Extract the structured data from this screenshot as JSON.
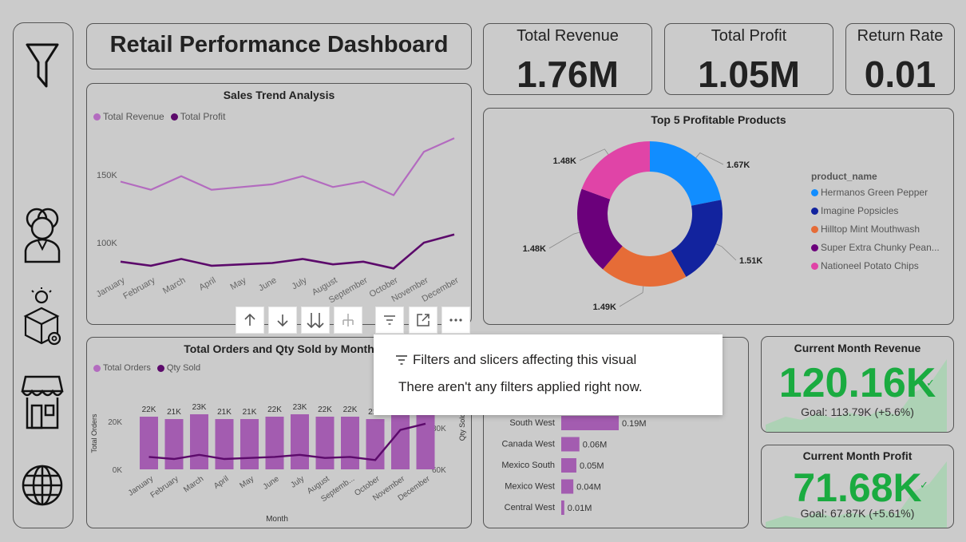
{
  "dashboard_title": "Retail Performance Dashboard",
  "kpis": {
    "revenue": {
      "label": "Total Revenue",
      "value": "1.76M"
    },
    "profit": {
      "label": "Total Profit",
      "value": "1.05M"
    },
    "return_rate": {
      "label": "Return Rate",
      "value": "0.01"
    }
  },
  "nav": {
    "icons": [
      "filter-icon",
      "people-icon",
      "product-box-icon",
      "store-icon",
      "globe-icon"
    ]
  },
  "sales_trend": {
    "title": "Sales Trend Analysis",
    "legend": [
      "Total Revenue",
      "Total Profit"
    ],
    "colors": {
      "revenue": "#b36bbf",
      "profit": "#5c0a6b"
    },
    "chart_data": {
      "type": "line",
      "title": "Sales Trend Analysis",
      "categories": [
        "January",
        "February",
        "March",
        "April",
        "May",
        "June",
        "July",
        "August",
        "September",
        "October",
        "November",
        "December"
      ],
      "y_ticks": [
        "150K",
        "100K"
      ],
      "series": [
        {
          "name": "Total Revenue",
          "values": [
            145000,
            139000,
            149000,
            139000,
            141000,
            143000,
            149000,
            141000,
            145000,
            135000,
            167000,
            177000
          ]
        },
        {
          "name": "Total Profit",
          "values": [
            86000,
            83000,
            88000,
            83000,
            84000,
            85000,
            88000,
            84000,
            86000,
            81000,
            100000,
            106000
          ]
        }
      ]
    }
  },
  "top_products": {
    "title": "Top 5 Profitable Products",
    "legend_title": "product_name",
    "chart_data": {
      "type": "pie",
      "title": "Top 5 Profitable Products",
      "labels": [
        "Hermanos Green Pepper",
        "Imagine Popsicles",
        "Hilltop Mint Mouthwash",
        "Super Extra Chunky Pean...",
        "Nationeel Potato Chips"
      ],
      "values": [
        1670,
        1510,
        1490,
        1480,
        1480
      ],
      "data_labels": [
        "1.67K",
        "1.51K",
        "1.49K",
        "1.48K",
        "1.48K"
      ],
      "colors": [
        "#118dff",
        "#12239e",
        "#e66c37",
        "#6b007b",
        "#e044a7"
      ]
    }
  },
  "orders_qty": {
    "title": "Total Orders and Qty Sold by Month",
    "legend": [
      "Total Orders",
      "Qty Sold"
    ],
    "xlabel": "Month",
    "ylabel_left": "Total Orders",
    "ylabel_right": "Qty Sold",
    "left_ticks": [
      "20K",
      "0K"
    ],
    "right_ticks": [
      "80K",
      "60K"
    ],
    "chart_data": {
      "type": "bar",
      "title": "Total Orders and Qty Sold by Month",
      "categories": [
        "January",
        "February",
        "March",
        "April",
        "May",
        "June",
        "July",
        "August",
        "Septemb...",
        "October",
        "November",
        "December"
      ],
      "series": [
        {
          "name": "Total Orders",
          "values": [
            22000,
            21000,
            23000,
            21000,
            21000,
            22000,
            23000,
            22000,
            22000,
            21000,
            24000,
            25000
          ],
          "labels": [
            "22K",
            "21K",
            "23K",
            "21K",
            "21K",
            "22K",
            "23K",
            "22K",
            "22K",
            "21K",
            "",
            ""
          ]
        },
        {
          "name": "Qty Sold",
          "values": [
            66000,
            65000,
            67000,
            65000,
            65500,
            66000,
            67000,
            65500,
            66000,
            64500,
            79000,
            82000
          ]
        }
      ]
    }
  },
  "region": {
    "chart_data": {
      "type": "bar",
      "categories": [
        "South West",
        "Canada West",
        "Mexico South",
        "Mexico West",
        "Central West"
      ],
      "values": [
        190000,
        60000,
        50000,
        40000,
        10000
      ],
      "labels": [
        "0.19M",
        "0.06M",
        "0.05M",
        "0.04M",
        "0.01M"
      ]
    }
  },
  "current_revenue": {
    "title": "Current Month Revenue",
    "value": "120.16K",
    "goal": "Goal: 113.79K (+5.6%)"
  },
  "current_profit": {
    "title": "Current Month Profit",
    "value": "71.68K",
    "goal": "Goal: 67.87K (+5.61%)"
  },
  "toolbar": {
    "buttons": [
      "arrow-up-icon",
      "arrow-down-icon",
      "double-arrow-down-icon",
      "expand-hierarchy-icon",
      "filter-lines-icon",
      "focus-mode-icon",
      "more-options-icon"
    ]
  },
  "tooltip": {
    "title": "Filters and slicers affecting this visual",
    "message": "There aren't any filters applied right now."
  },
  "colors": {
    "accent_green": "#1aab40",
    "purple_light": "#b36bbf",
    "purple_dark": "#5c0a6b"
  }
}
